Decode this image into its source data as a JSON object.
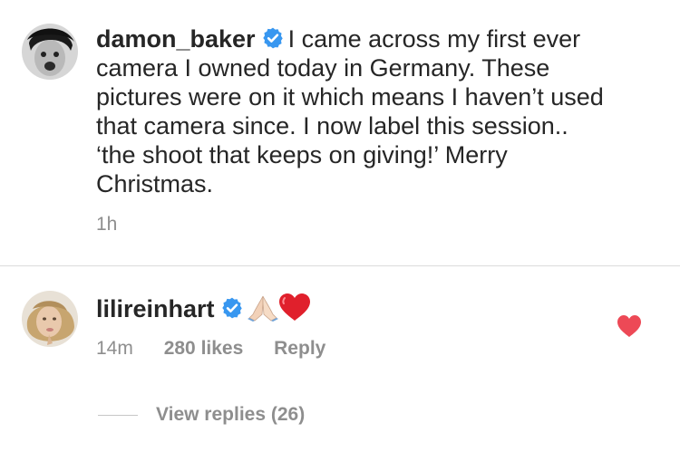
{
  "post": {
    "author": "damon_baker",
    "caption": "I came across my first ever camera I owned today in Germany. These pictures were on it which means I haven’t used that camera since. I now label this session.. ‘the shoot that keeps on giving!’ Merry Christmas.",
    "time": "1h",
    "author_verified": true
  },
  "comment": {
    "author": "lilireinhart",
    "author_verified": true,
    "emojis": [
      "folded-hands",
      "red-heart"
    ],
    "time": "14m",
    "likes": "280 likes",
    "reply_label": "Reply",
    "liked": true
  },
  "replies": {
    "label": "View replies (26)"
  },
  "colors": {
    "text": "#262626",
    "muted": "#8e8e8e",
    "verified_blue": "#3897f0",
    "like_red": "#ed4956",
    "divider": "#dbdbdb"
  }
}
